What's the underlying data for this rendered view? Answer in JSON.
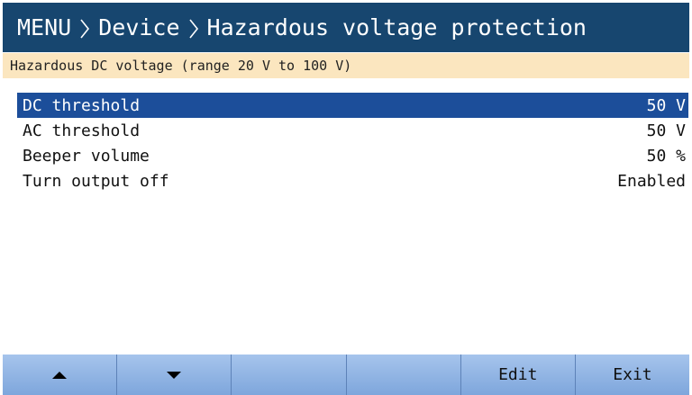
{
  "breadcrumb": {
    "items": [
      "MENU",
      "Device",
      "Hazardous voltage protection"
    ],
    "separator_icon": "chevron-right-icon"
  },
  "info": {
    "text": "Hazardous DC voltage (range 20 V to 100 V)"
  },
  "settings": [
    {
      "label": "DC threshold",
      "value": "50 V",
      "selected": true
    },
    {
      "label": "AC threshold",
      "value": "50 V",
      "selected": false
    },
    {
      "label": "Beeper volume",
      "value": "50 %",
      "selected": false
    },
    {
      "label": "Turn output off",
      "value": "Enabled",
      "selected": false
    }
  ],
  "softkeys": [
    {
      "label": "",
      "icon": "arrow-up-icon"
    },
    {
      "label": "",
      "icon": "arrow-down-icon"
    },
    {
      "label": ""
    },
    {
      "label": ""
    },
    {
      "label": "Edit"
    },
    {
      "label": "Exit"
    }
  ],
  "colors": {
    "title_bar": "#17466f",
    "info_bar": "#fbe6bf",
    "selected_row": "#1c4e9a",
    "softkey": "#8bafe0"
  }
}
